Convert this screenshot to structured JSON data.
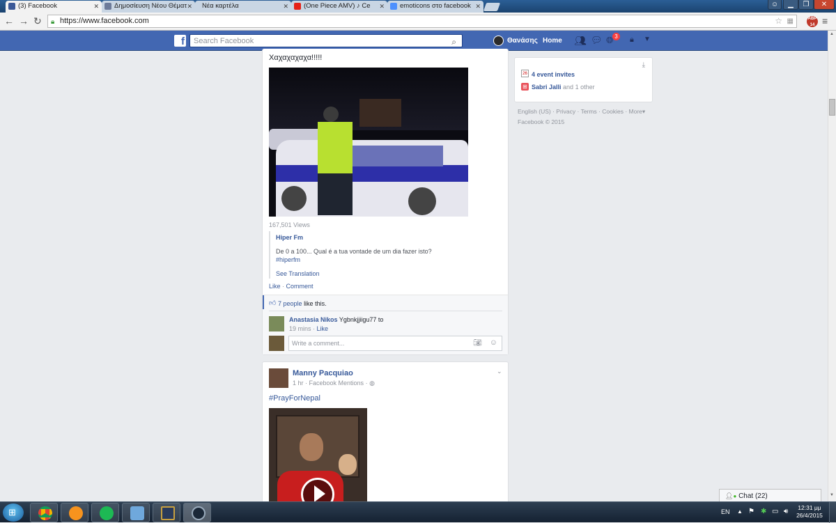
{
  "browser": {
    "tabs": [
      {
        "title": "(3) Facebook",
        "active": true
      },
      {
        "title": "Δημοσίευση Νέου Θέματ",
        "active": false
      },
      {
        "title": "Νέα καρτέλα",
        "active": false
      },
      {
        "title": "(One Piece AMV) ♪ Ce",
        "active": false
      },
      {
        "title": "emoticons στο facebook",
        "active": false
      }
    ],
    "url": "https://www.facebook.com",
    "adblock_count": "14"
  },
  "fb_header": {
    "search_placeholder": "Search Facebook",
    "user_name": "Θανάσης",
    "home_label": "Home",
    "notifications_count": "3"
  },
  "post1": {
    "caption": "Χαχαχαχαχα!!!!!",
    "views": "167,501 Views",
    "shared_page": "Hiper Fm",
    "shared_text": "De 0 a 100... Qual é a tua vontade de um dia fazer isto?",
    "hashtag": "#hiperfm",
    "see_translation": "See Translation",
    "shared_like": "Like",
    "shared_comment": "Comment",
    "likes_people": "7 people",
    "likes_suffix": "like this.",
    "comment_author": "Anastasia Nikos",
    "comment_text": "Ygbnkjjiigu77 to",
    "comment_time": "19 mins",
    "comment_like": "Like",
    "comment_placeholder": "Write a comment..."
  },
  "post2": {
    "author": "Manny Pacquiao",
    "time": "1 hr",
    "source": "Facebook Mentions",
    "hashtag": "#PrayForNepal"
  },
  "right_column": {
    "event_invites": "4 event invites",
    "calendar_day": "26",
    "birthday_name": "Sabri Jalli",
    "birthday_suffix": "and 1 other",
    "footer": [
      "English (US)",
      "Privacy",
      "Terms",
      "Cookies",
      "More"
    ],
    "copyright": "Facebook © 2015"
  },
  "chat": {
    "label": "Chat (22)"
  },
  "taskbar": {
    "language": "EN",
    "time": "12:31 μμ",
    "date": "26/4/2015"
  },
  "colors": {
    "fb_blue": "#4267b2",
    "link": "#365899",
    "badge_red": "#fa3e3e"
  }
}
